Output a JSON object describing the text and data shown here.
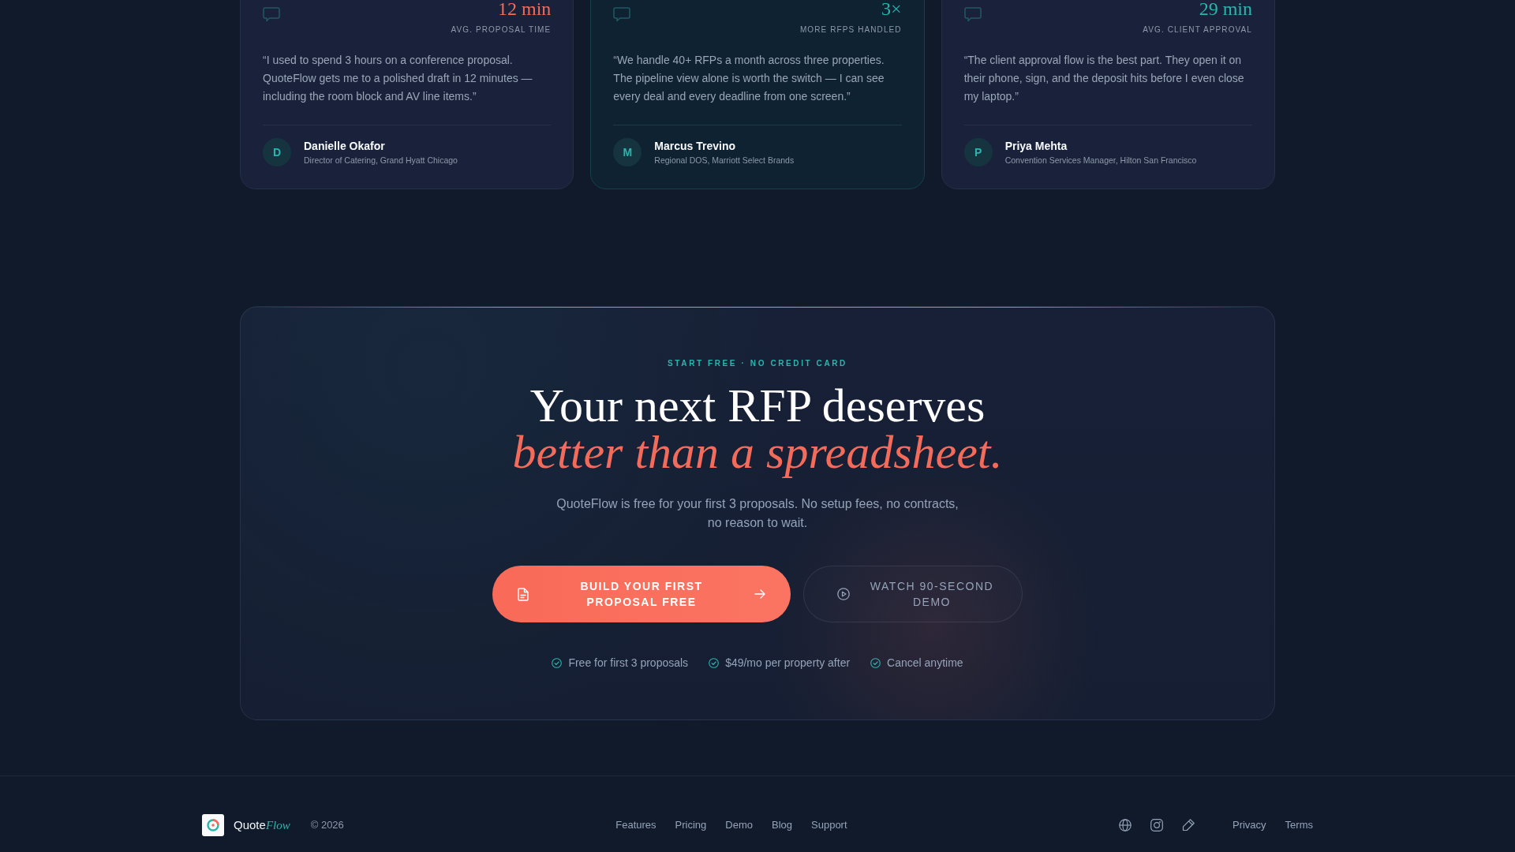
{
  "testimonials": [
    {
      "featured": false,
      "stat": "12 min",
      "color": "#f26b5b",
      "stat_label": "AVG. PROPOSAL TIME",
      "quote": "“I used to spend 3 hours on a conference proposal. QuoteFlow gets me to a polished draft in 12 minutes — including the room block and AV line items.”",
      "initial": "D",
      "name": "Danielle Okafor",
      "role": "Director of Catering, Grand Hyatt Chicago"
    },
    {
      "featured": true,
      "stat": "3×",
      "color": "#2bb5ad",
      "stat_label": "MORE RFPS HANDLED",
      "quote": "“We handle 40+ RFPs a month across three properties. The pipeline view alone is worth the switch — I can see every deal and every deadline from one screen.”",
      "initial": "M",
      "name": "Marcus Trevino",
      "role": "Regional DOS, Marriott Select Brands"
    },
    {
      "featured": false,
      "stat": "29 min",
      "color": "#2bb5ad",
      "stat_label": "AVG. CLIENT APPROVAL",
      "quote": "“The client approval flow is the best part. They open it on their phone, sign, and the deposit hits before I even close my laptop.”",
      "initial": "P",
      "name": "Priya Mehta",
      "role": "Convention Services Manager, Hilton San Francisco"
    }
  ],
  "cta": {
    "eyebrow": "START FREE · NO CREDIT CARD",
    "headline": "Your next RFP deserves *better than a spreadsheet.*",
    "body": "QuoteFlow is free for your first 3 proposals. No setup fees, no contracts, no reason to wait.",
    "buttons": [
      {
        "kind": "primary",
        "label": "BUILD YOUR FIRST PROPOSAL FREE"
      },
      {
        "kind": "secondary",
        "label": "WATCH 90-SECOND DEMO"
      }
    ],
    "perks": [
      "Free for first 3 proposals",
      "$49/mo per property after",
      "Cancel anytime"
    ]
  },
  "footer": {
    "brand": "Quote",
    "brand_accent": "Flow",
    "copyright": "© 2026",
    "links": [
      "Features",
      "Pricing",
      "Demo",
      "Blog",
      "Support"
    ],
    "legal_links": [
      "Privacy",
      "Terms"
    ]
  }
}
